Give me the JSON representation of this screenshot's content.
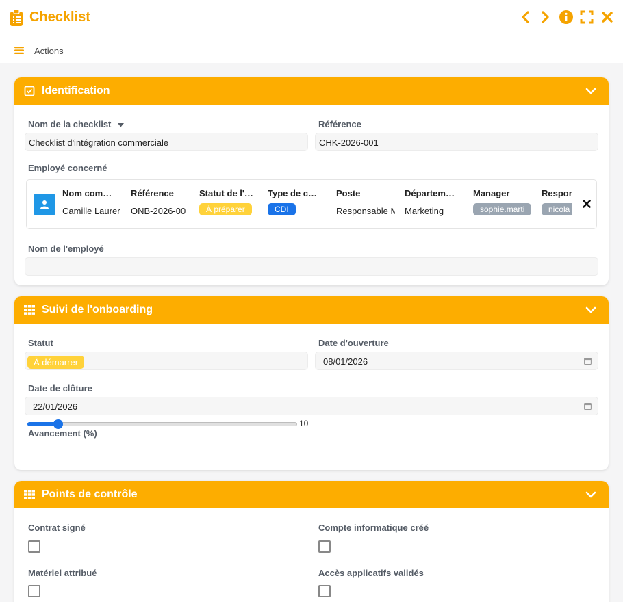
{
  "app": {
    "title": "Checklist"
  },
  "toolbar": {
    "actions_label": "Actions"
  },
  "colors": {
    "accent": "#fdad00",
    "title": "#f5a300",
    "blue": "#1f97e6",
    "yellow_pill": "#ffd23a",
    "blue_pill": "#1a73e8",
    "grey_pill": "#9aa5b1"
  },
  "identification": {
    "title": "Identification",
    "name_label": "Nom de la checklist",
    "name_value": "Checklist d'intégration commerciale",
    "ref_label": "Référence",
    "ref_value": "CHK-2026-001",
    "employee_label": "Employé concerné",
    "employee_table": {
      "headers": [
        "Nom com…",
        "Référence",
        "Statut de l'…",
        "Type de c…",
        "Poste",
        "Départem…",
        "Manager",
        "Respon"
      ],
      "row": {
        "name": "Camille Laurer",
        "reference": "ONB-2026-00",
        "status": "À préparer",
        "contract": "CDI",
        "position": "Responsable M",
        "department": "Marketing",
        "manager": "sophie.marti",
        "owner": "nicola"
      }
    },
    "employee_name_label": "Nom de l'employé",
    "employee_name_value": ""
  },
  "onboarding": {
    "title": "Suivi de l'onboarding",
    "status_label": "Statut",
    "status_value": "À démarrer",
    "open_date_label": "Date d'ouverture",
    "open_date_value": "08/01/2026",
    "close_date_label": "Date de clôture",
    "close_date_value": "22/01/2026",
    "progress_label": "Avancement (%)",
    "progress_value": "10",
    "progress_percent": 10
  },
  "checkpoints": {
    "title": "Points de contrôle",
    "items": [
      {
        "label": "Contrat signé",
        "checked": false
      },
      {
        "label": "Compte informatique créé",
        "checked": false
      },
      {
        "label": "Matériel attribué",
        "checked": false
      },
      {
        "label": "Accès applicatifs validés",
        "checked": false
      }
    ]
  }
}
